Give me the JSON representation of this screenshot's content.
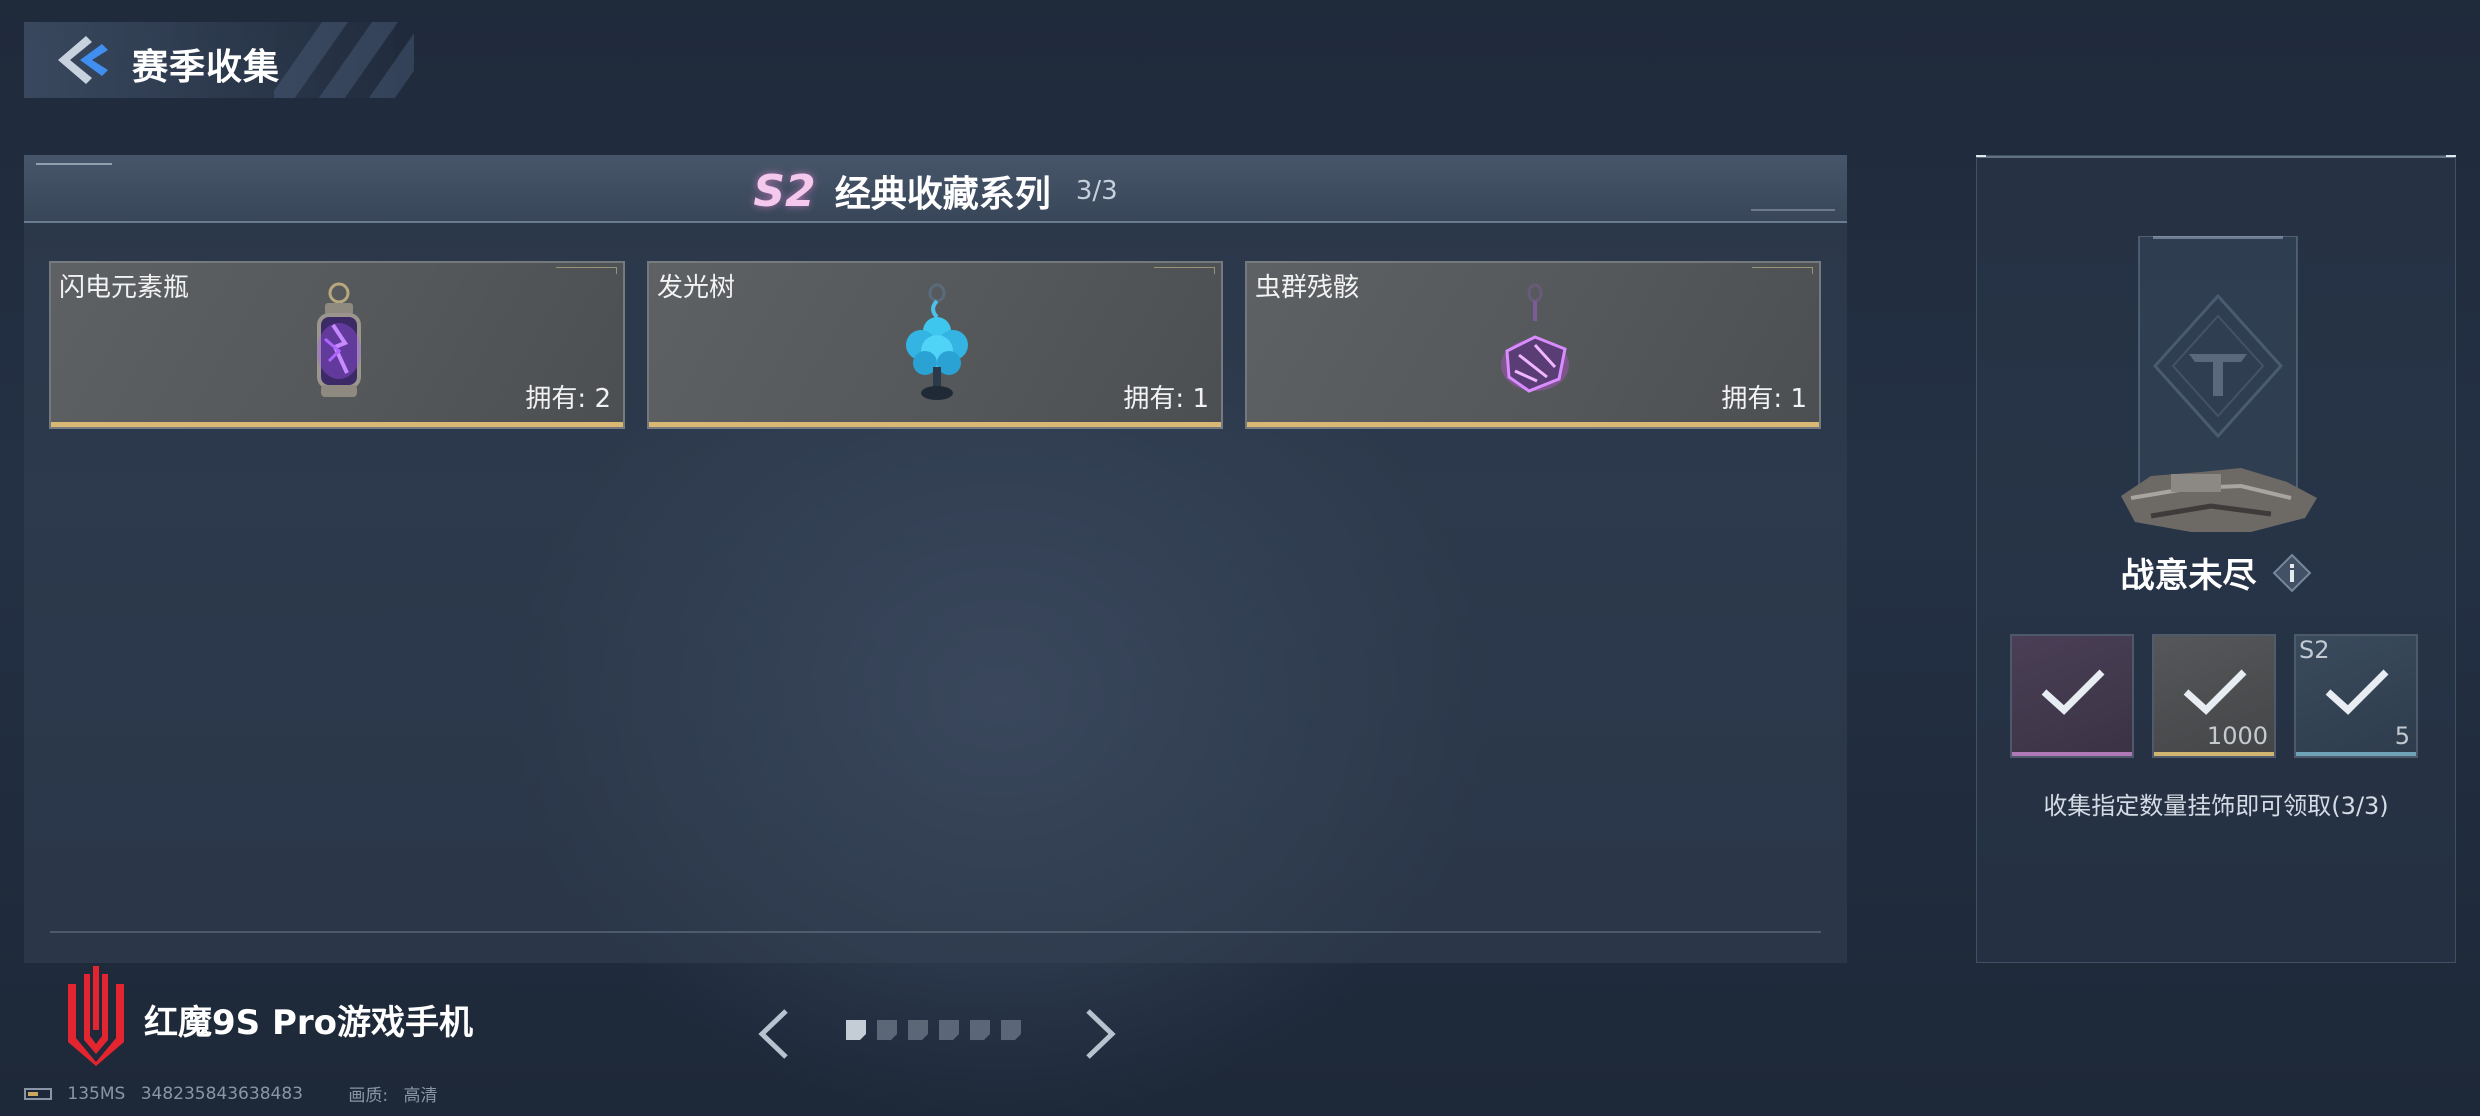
{
  "header": {
    "title": "赛季收集",
    "back_icon": "back-arrow-icon"
  },
  "collection": {
    "season_badge": "S2",
    "series_name": "经典收藏系列",
    "progress": "3/3",
    "items": [
      {
        "name": "闪电元素瓶",
        "owned": "拥有: 2",
        "icon": "lightning-bottle-icon",
        "rarity_color": "#d8b873"
      },
      {
        "name": "发光树",
        "owned": "拥有: 1",
        "icon": "glowing-tree-icon",
        "rarity_color": "#d8b873"
      },
      {
        "name": "虫群残骸",
        "owned": "拥有: 1",
        "icon": "swarm-remains-icon",
        "rarity_color": "#d8b873"
      }
    ]
  },
  "pager": {
    "page_count": 6,
    "active_index": 0,
    "prev_icon": "chevron-left-icon",
    "next_icon": "chevron-right-icon"
  },
  "reward": {
    "name": "战意未尽",
    "info_icon": "info-icon",
    "slots": [
      {
        "icon": "check-icon",
        "qty": "",
        "tag": "",
        "claimed": true
      },
      {
        "icon": "check-icon",
        "qty": "1000",
        "tag": "",
        "claimed": true
      },
      {
        "icon": "check-icon",
        "qty": "5",
        "tag": "S2",
        "claimed": true
      }
    ],
    "description": "收集指定数量挂饰即可领取(3/3)"
  },
  "brand": {
    "text": "红魔9S Pro游戏手机",
    "logo": "red-magic-logo"
  },
  "status": {
    "latency": "135MS",
    "uid": "348235843638483",
    "quality_label": "画质:",
    "quality_value": "高清"
  },
  "colors": {
    "accent_gold": "#d8b873",
    "season_pink": "#f5c8ee",
    "brand_red": "#e3252f"
  }
}
